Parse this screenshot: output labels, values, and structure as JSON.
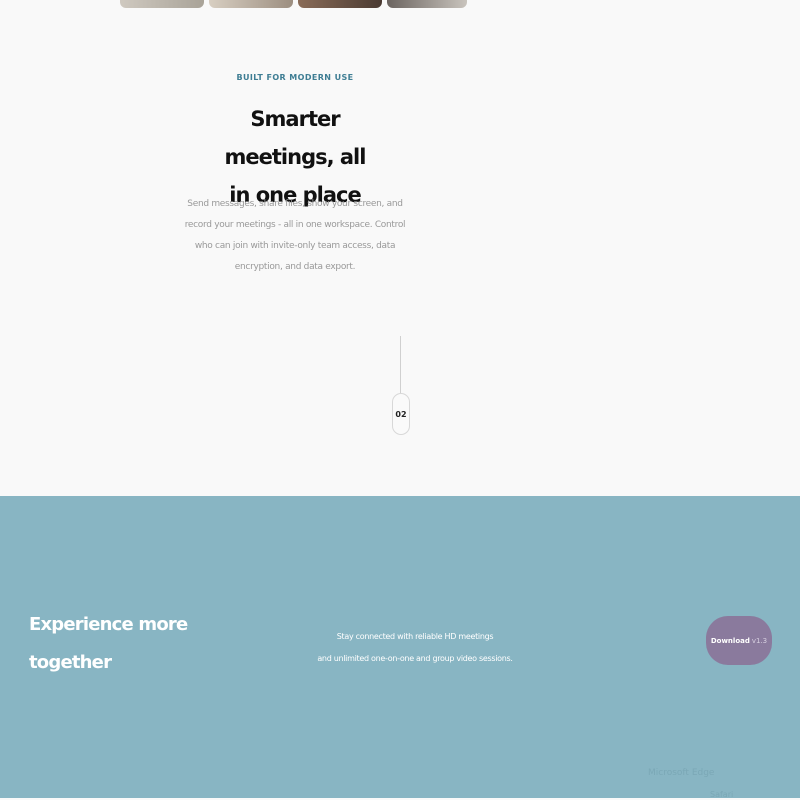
{
  "feature": {
    "eyebrow": "BUILT FOR MODERN USE",
    "title_line1": "Smarter meetings, all",
    "title_line2": "in one place",
    "description": "Send messages, share files, show your screen, and record your meetings - all in one workspace. Control who can join with invite-only team access, data encryption, and data export."
  },
  "step": {
    "number": "02"
  },
  "cta": {
    "title_line1": "Experience more",
    "title_line2": "together",
    "text_line1": "Stay connected with reliable HD meetings",
    "text_line2": "and unlimited one-on-one and group video sessions.",
    "download_label": "Download",
    "download_version": "v1.3",
    "ghost_line1": "Microsoft Edge",
    "ghost_line2": "Safari"
  },
  "colors": {
    "accent": "#3f7e94",
    "cta_background": "#88b5c3",
    "button": "#8a7a9d"
  }
}
